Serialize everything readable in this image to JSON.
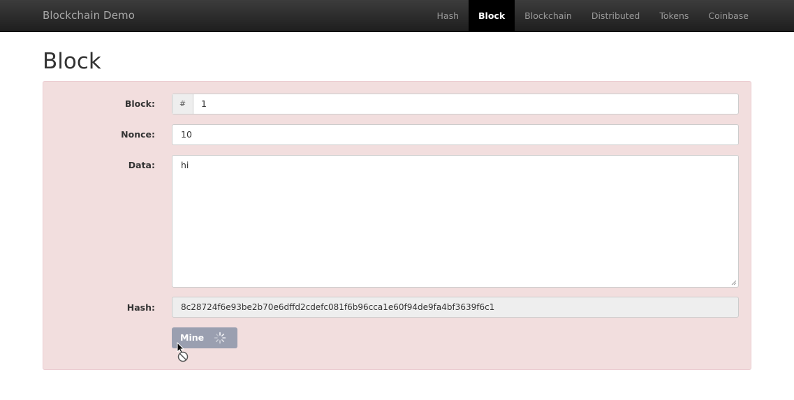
{
  "navbar": {
    "brand": "Blockchain Demo",
    "items": [
      {
        "label": "Hash",
        "active": false
      },
      {
        "label": "Block",
        "active": true
      },
      {
        "label": "Blockchain",
        "active": false
      },
      {
        "label": "Distributed",
        "active": false
      },
      {
        "label": "Tokens",
        "active": false
      },
      {
        "label": "Coinbase",
        "active": false
      }
    ]
  },
  "page": {
    "title": "Block"
  },
  "form": {
    "block_label": "Block:",
    "block_prefix": "#",
    "block_value": "1",
    "nonce_label": "Nonce:",
    "nonce_value": "10",
    "data_label": "Data:",
    "data_value": "hi",
    "hash_label": "Hash:",
    "hash_value": "8c28724f6e93be2b70e6dffd2cdefc081f6b96cca1e60f94de9fa4bf3639f6c1",
    "mine_label": "Mine"
  },
  "colors": {
    "panel_bg": "#f2dede",
    "panel_border": "#ebccd1",
    "navbar_bg": "#222222",
    "mine_button": "#9a9fb0"
  },
  "icons": {
    "spinner": "loading-spinner-icon",
    "cursor": "not-allowed-cursor-icon"
  }
}
